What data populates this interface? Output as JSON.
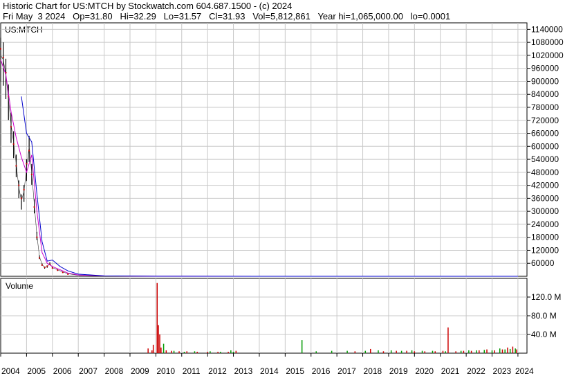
{
  "header": {
    "line1": "Historic Chart for US:MTCH by Stockwatch.com 604.687.1500 - (c) 2024",
    "line2": "Fri May  3 2024   Op=31.80   Hi=32.29   Lo=31.57   Cl=31.93   Vol=5,812,861   Year hi=1,065,000.00   lo=0.0001"
  },
  "chart_data": [
    {
      "type": "line",
      "title": "US:MTCH",
      "y_ticks": [
        "1140000",
        "1080000",
        "1020000",
        "960000",
        "900000",
        "840000",
        "780000",
        "720000",
        "660000",
        "600000",
        "540000",
        "480000",
        "420000",
        "360000",
        "300000",
        "240000",
        "180000",
        "120000",
        "60000"
      ],
      "ylim": [
        0,
        1170000
      ],
      "x_ticks": [
        "2004",
        "2005",
        "2006",
        "2007",
        "2008",
        "2009",
        "2010",
        "2011",
        "2012",
        "2013",
        "2014",
        "2015",
        "2016",
        "2017",
        "2018",
        "2019",
        "2020",
        "2021",
        "2022",
        "2023",
        "2024"
      ],
      "grid": true,
      "series": [
        {
          "style": "price-bars",
          "color": "#000000",
          "x": [
            2004.0,
            2004.1,
            2004.2,
            2004.3,
            2004.4,
            2004.5,
            2004.6,
            2004.7,
            2004.8,
            2004.9,
            2005.0,
            2005.1,
            2005.2,
            2005.3,
            2005.4,
            2005.5,
            2005.6,
            2005.7,
            2005.8,
            2005.9,
            2006.0,
            2006.2,
            2006.4,
            2006.6,
            2006.8,
            2007.0,
            2008.0,
            2010.0,
            2012.0,
            2014.0,
            2016.0,
            2018.0,
            2020.0,
            2022.0,
            2024.0
          ],
          "y": [
            1020000,
            1000000,
            930000,
            820000,
            700000,
            620000,
            520000,
            410000,
            350000,
            390000,
            500000,
            600000,
            480000,
            330000,
            190000,
            90000,
            55000,
            40000,
            45000,
            60000,
            40000,
            30000,
            20000,
            12000,
            8000,
            5000,
            2000,
            500,
            200,
            100,
            60,
            60,
            50,
            40,
            32
          ]
        },
        {
          "style": "close-marks",
          "color": "#cc0000",
          "x": [
            2004.0,
            2004.1,
            2004.2,
            2004.3,
            2004.4,
            2004.5,
            2004.6,
            2004.7,
            2004.8,
            2004.9,
            2005.0,
            2005.1,
            2005.2,
            2005.3,
            2005.4,
            2005.5,
            2005.6,
            2005.7,
            2005.8,
            2005.9,
            2006.0,
            2006.2,
            2006.4,
            2006.6
          ],
          "y": [
            1050000,
            1010000,
            940000,
            830000,
            690000,
            610000,
            510000,
            420000,
            360000,
            400000,
            520000,
            580000,
            470000,
            320000,
            180000,
            85000,
            52000,
            42000,
            47000,
            55000,
            38000,
            28000,
            18000,
            10000
          ]
        },
        {
          "style": "line",
          "name": "",
          "color": "#cc00cc",
          "x": [
            2004.0,
            2004.2,
            2004.4,
            2004.6,
            2004.8,
            2005.0,
            2005.2,
            2005.4,
            2005.6,
            2005.8,
            2006.0,
            2006.3,
            2006.6,
            2007.0,
            2008.0,
            2010.0,
            2014.0,
            2020.0,
            2024.0
          ],
          "y": [
            1000000,
            930000,
            760000,
            640000,
            550000,
            480000,
            560000,
            300000,
            110000,
            60000,
            45000,
            30000,
            15000,
            6000,
            1500,
            400,
            100,
            60,
            40
          ]
        },
        {
          "style": "line",
          "name": "",
          "color": "#0000cc",
          "x": [
            2004.8,
            2005.0,
            2005.2,
            2005.4,
            2005.6,
            2005.8,
            2006.0,
            2006.3,
            2006.6,
            2007.0,
            2008.0,
            2010.0,
            2014.0,
            2020.0,
            2024.0
          ],
          "y": [
            830000,
            660000,
            620000,
            380000,
            160000,
            70000,
            75000,
            45000,
            25000,
            10000,
            2000,
            500,
            100,
            60,
            40
          ]
        }
      ]
    },
    {
      "type": "bar",
      "title": "Volume",
      "y_ticks": [
        "120.0 M",
        "80.0 M",
        "40.0 M"
      ],
      "ylim": [
        0,
        160
      ],
      "x_ticks": [
        "2004",
        "2005",
        "2006",
        "2007",
        "2008",
        "2009",
        "2010",
        "2011",
        "2012",
        "2013",
        "2014",
        "2015",
        "2016",
        "2017",
        "2018",
        "2019",
        "2020",
        "2021",
        "2022",
        "2023",
        "2024"
      ],
      "grid": true,
      "series": [
        {
          "color": "#cc0000",
          "x": [
            2009.7,
            2009.85,
            2009.9,
            2010.05,
            2010.1,
            2010.15,
            2010.2,
            2010.4,
            2010.6,
            2010.9,
            2011.2,
            2011.6,
            2012.0,
            2012.4,
            2012.8,
            2013.1,
            2017.7,
            2018.3,
            2018.8,
            2019.3,
            2019.7,
            2020.0,
            2020.4,
            2020.8,
            2021.1,
            2021.3,
            2021.6,
            2021.9,
            2022.2,
            2022.5,
            2022.8,
            2023.1,
            2023.4,
            2023.6,
            2023.8,
            2023.95
          ],
          "values": [
            10,
            6,
            18,
            150,
            60,
            40,
            12,
            6,
            5,
            4,
            4,
            3,
            3,
            3,
            3,
            5,
            4,
            9,
            4,
            5,
            5,
            4,
            4,
            4,
            5,
            55,
            4,
            5,
            5,
            6,
            8,
            6,
            8,
            12,
            14,
            8
          ]
        },
        {
          "color": "#009900",
          "x": [
            2010.3,
            2010.7,
            2011.1,
            2011.5,
            2012.1,
            2012.5,
            2012.9,
            2013.0,
            2015.65,
            2016.2,
            2016.8,
            2017.4,
            2018.1,
            2018.6,
            2019.1,
            2019.5,
            2019.9,
            2020.3,
            2020.7,
            2021.2,
            2021.8,
            2022.1,
            2022.4,
            2022.7,
            2023.0,
            2023.3,
            2023.5,
            2023.7,
            2023.9
          ],
          "values": [
            20,
            5,
            3,
            4,
            4,
            3,
            6,
            3,
            28,
            4,
            5,
            5,
            5,
            6,
            6,
            5,
            6,
            5,
            5,
            4,
            5,
            6,
            6,
            7,
            6,
            10,
            8,
            9,
            10
          ]
        }
      ]
    }
  ]
}
